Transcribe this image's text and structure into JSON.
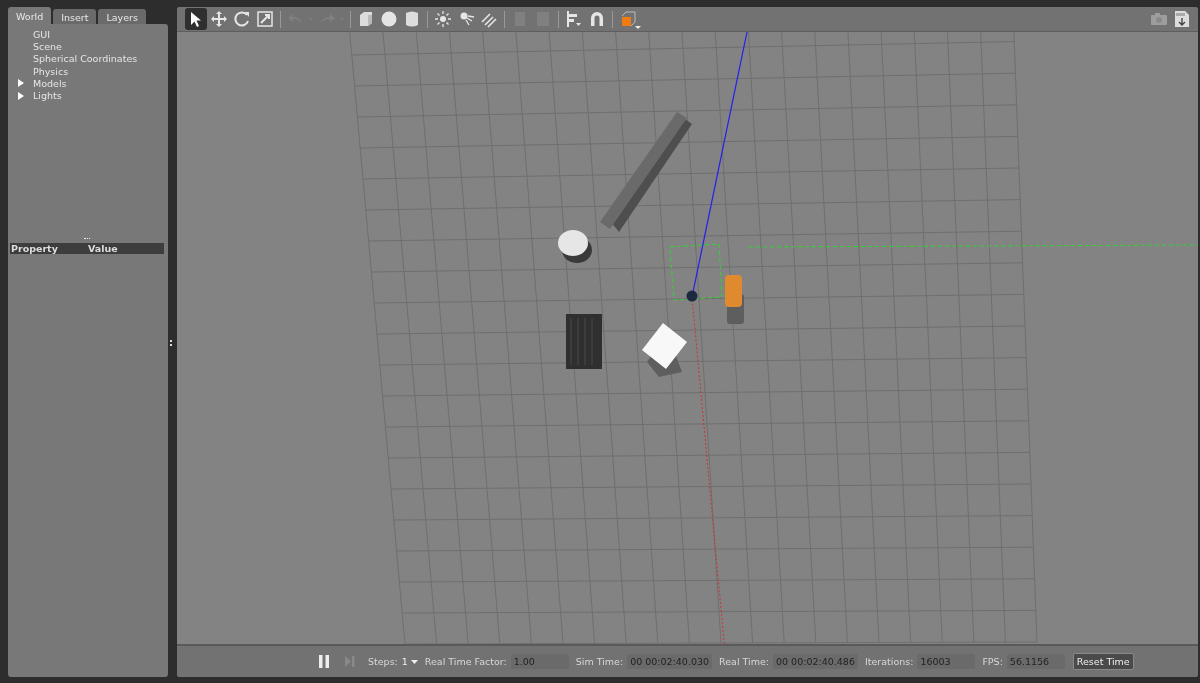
{
  "left_panel": {
    "tabs": [
      {
        "label": "World",
        "selected": true
      },
      {
        "label": "Insert",
        "selected": false
      },
      {
        "label": "Layers",
        "selected": false
      }
    ],
    "tree": [
      {
        "label": "GUI",
        "kind": "leaf"
      },
      {
        "label": "Scene",
        "kind": "leaf"
      },
      {
        "label": "Spherical Coordinates",
        "kind": "leaf"
      },
      {
        "label": "Physics",
        "kind": "leaf"
      },
      {
        "label": "Models",
        "kind": "group",
        "expanded": false
      },
      {
        "label": "Lights",
        "kind": "group",
        "expanded": false
      }
    ],
    "property_table": {
      "columns": [
        "Property",
        "Value"
      ]
    }
  },
  "toolbar": {
    "tools": [
      {
        "kind": "select",
        "selected": true,
        "disabled": false
      },
      {
        "kind": "translate",
        "selected": false,
        "disabled": false
      },
      {
        "kind": "rotate",
        "selected": false,
        "disabled": false
      },
      {
        "kind": "scale",
        "selected": false,
        "disabled": false
      },
      {
        "kind": "sep"
      },
      {
        "kind": "undo",
        "selected": false,
        "disabled": true
      },
      {
        "kind": "redo",
        "selected": false,
        "disabled": true
      },
      {
        "kind": "sep"
      },
      {
        "kind": "box",
        "selected": false,
        "disabled": false
      },
      {
        "kind": "sphere",
        "selected": false,
        "disabled": false
      },
      {
        "kind": "cylinder",
        "selected": false,
        "disabled": false
      },
      {
        "kind": "sep"
      },
      {
        "kind": "sun",
        "selected": false,
        "disabled": false
      },
      {
        "kind": "spot",
        "selected": false,
        "disabled": false
      },
      {
        "kind": "directional",
        "selected": false,
        "disabled": false
      },
      {
        "kind": "sep"
      },
      {
        "kind": "copy",
        "selected": false,
        "disabled": true
      },
      {
        "kind": "paste",
        "selected": false,
        "disabled": true
      },
      {
        "kind": "sep"
      },
      {
        "kind": "align",
        "selected": false,
        "disabled": false
      },
      {
        "kind": "magnet",
        "selected": false,
        "disabled": false
      },
      {
        "kind": "sep"
      },
      {
        "kind": "view",
        "selected": false,
        "disabled": false
      }
    ],
    "right_tools": [
      {
        "kind": "camera",
        "selected": false,
        "disabled": true
      },
      {
        "kind": "log",
        "selected": false,
        "disabled": false
      }
    ]
  },
  "bottom_bar": {
    "running": true,
    "steps_label": "Steps:",
    "steps_value": "1",
    "fields": [
      {
        "label": "Real Time Factor:",
        "value": "1.00",
        "kind": "wide"
      },
      {
        "label": "Sim Time:",
        "value": "00 00:02:40.030",
        "kind": "time"
      },
      {
        "label": "Real Time:",
        "value": "00 00:02:40.486",
        "kind": "time"
      },
      {
        "label": "Iterations:",
        "value": "16003",
        "kind": "wide"
      },
      {
        "label": "FPS:",
        "value": "56.1156",
        "kind": "mid"
      }
    ],
    "reset_button": "Reset Time"
  }
}
